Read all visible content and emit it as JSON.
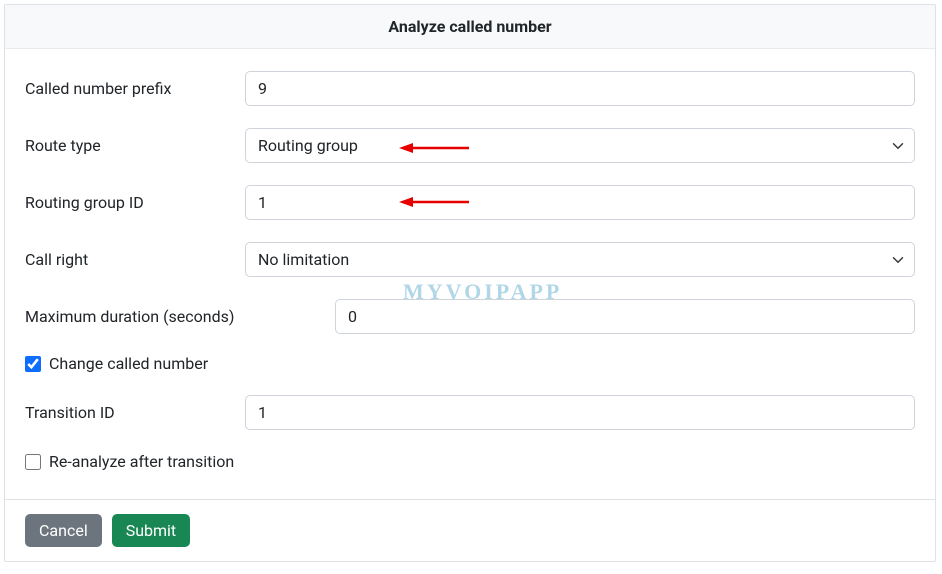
{
  "header": {
    "title": "Analyze called number"
  },
  "fields": {
    "called_number_prefix": {
      "label": "Called number prefix",
      "value": "9"
    },
    "route_type": {
      "label": "Route type",
      "selected": "Routing group"
    },
    "routing_group_id": {
      "label": "Routing group ID",
      "value": "1"
    },
    "call_right": {
      "label": "Call right",
      "selected": "No limitation"
    },
    "maximum_duration": {
      "label": "Maximum duration (seconds)",
      "value": "0"
    },
    "change_called_number": {
      "label": "Change called number",
      "checked": true
    },
    "transition_id": {
      "label": "Transition ID",
      "value": "1"
    },
    "reanalyze_after_transition": {
      "label": "Re-analyze after transition",
      "checked": false
    }
  },
  "buttons": {
    "cancel": "Cancel",
    "submit": "Submit"
  },
  "watermark": "MYVOIPAPP"
}
